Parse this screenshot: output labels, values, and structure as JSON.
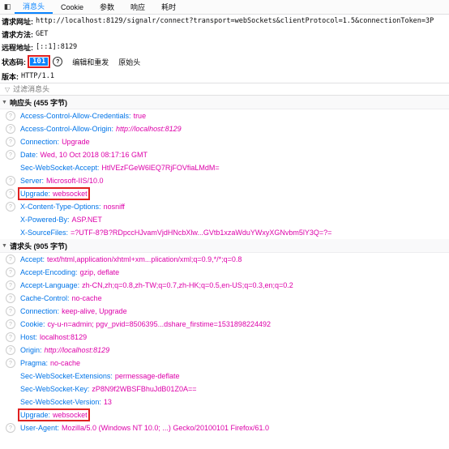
{
  "tabs": {
    "toggle_glyph": "◧",
    "items": [
      {
        "label": "消息头",
        "active": true
      },
      {
        "label": "Cookie"
      },
      {
        "label": "参数"
      },
      {
        "label": "响应"
      },
      {
        "label": "耗时"
      }
    ]
  },
  "summary": {
    "url_label": "请求网址:",
    "url_value": "http://localhost:8129/signalr/connect?transport=webSockets&clientProtocol=1.5&connectionToken=3P",
    "method_label": "请求方法:",
    "method_value": "GET",
    "remote_label": "远程地址:",
    "remote_value": "[::1]:8129",
    "status_label": "状态码:",
    "status_code": "101",
    "help_glyph": "?",
    "edit_resend": "编辑和重发",
    "raw_headers": "原始头",
    "version_label": "版本:",
    "version_value": "HTTP/1.1"
  },
  "filter": {
    "icon": "▽",
    "placeholder": "过滤消息头"
  },
  "response_section": {
    "title": "响应头 (455 字节)",
    "headers": [
      {
        "name": "Access-Control-Allow-Credentials",
        "value": "true",
        "help": true
      },
      {
        "name": "Access-Control-Allow-Origin",
        "value": "http://localhost:8129",
        "help": true,
        "italic": true
      },
      {
        "name": "Connection",
        "value": "Upgrade",
        "help": true
      },
      {
        "name": "Date",
        "value": "Wed, 10 Oct 2018 08:17:16 GMT",
        "help": true
      },
      {
        "name": "Sec-WebSocket-Accept",
        "value": "HtlVEzFGeW6lEQ7RjFOVfiaLMdM=",
        "help": false
      },
      {
        "name": "Server",
        "value": "Microsoft-IIS/10.0",
        "help": true
      },
      {
        "name": "Upgrade",
        "value": "websocket",
        "help": true,
        "highlight": true
      },
      {
        "name": "X-Content-Type-Options",
        "value": "nosniff",
        "help": true
      },
      {
        "name": "X-Powered-By",
        "value": "ASP.NET",
        "help": false
      },
      {
        "name": "X-SourceFiles",
        "value": "=?UTF-8?B?RDpccHJvamVjdHNcbXlw...GVtb1xzaWduYWxyXGNvbm5lY3Q=?=",
        "help": false
      }
    ]
  },
  "request_section": {
    "title": "请求头 (905 字节)",
    "headers": [
      {
        "name": "Accept",
        "value": "text/html,application/xhtml+xm...plication/xml;q=0.9,*/*;q=0.8",
        "help": true
      },
      {
        "name": "Accept-Encoding",
        "value": "gzip, deflate",
        "help": true
      },
      {
        "name": "Accept-Language",
        "value": "zh-CN,zh;q=0.8,zh-TW;q=0.7,zh-HK;q=0.5,en-US;q=0.3,en;q=0.2",
        "help": true
      },
      {
        "name": "Cache-Control",
        "value": "no-cache",
        "help": true
      },
      {
        "name": "Connection",
        "value": "keep-alive, Upgrade",
        "help": true
      },
      {
        "name": "Cookie",
        "value": "cy-u-n=admin; pgv_pvid=8506395...dshare_firstime=1531898224492",
        "help": true
      },
      {
        "name": "Host",
        "value": "localhost:8129",
        "help": true
      },
      {
        "name": "Origin",
        "value": "http://localhost:8129",
        "help": true,
        "italic": true
      },
      {
        "name": "Pragma",
        "value": "no-cache",
        "help": true
      },
      {
        "name": "Sec-WebSocket-Extensions",
        "value": "permessage-deflate",
        "help": false
      },
      {
        "name": "Sec-WebSocket-Key",
        "value": "zP8N9f2WBSFBhuJdB01Z0A==",
        "help": false
      },
      {
        "name": "Sec-WebSocket-Version",
        "value": "13",
        "help": false
      },
      {
        "name": "Upgrade",
        "value": "websocket",
        "help": false,
        "highlight": true
      },
      {
        "name": "User-Agent",
        "value": "Mozilla/5.0 (Windows NT 10.0; ...) Gecko/20100101 Firefox/61.0",
        "help": true
      }
    ]
  },
  "colors": {
    "header_name": "#0074e8",
    "header_value": "#dd00a9",
    "active_tab": "#0a84ff",
    "highlight_box": "#e02020"
  }
}
